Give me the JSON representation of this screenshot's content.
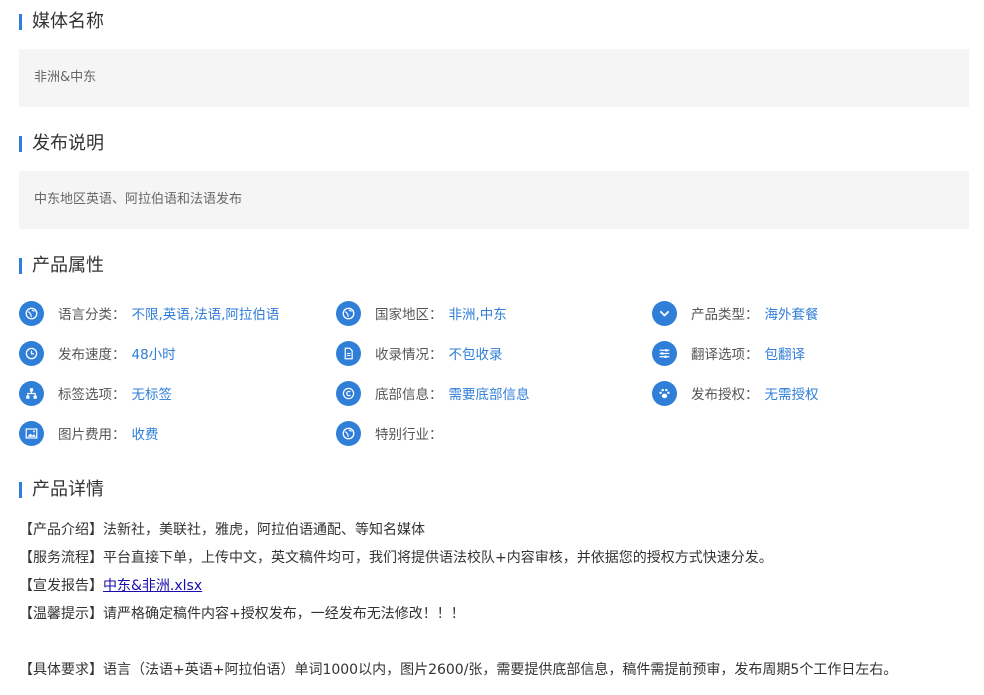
{
  "sections": {
    "media": {
      "title": "媒体名称",
      "value": "非洲&中东"
    },
    "publish": {
      "title": "发布说明",
      "value": "中东地区英语、阿拉伯语和法语发布"
    },
    "attributes": {
      "title": "产品属性"
    },
    "details": {
      "title": "产品详情"
    }
  },
  "attributes": [
    {
      "label": "语言分类：",
      "value": "不限,英语,法语,阿拉伯语",
      "icon": "globe-icon"
    },
    {
      "label": "国家地区：",
      "value": "非洲,中东",
      "icon": "globe-icon"
    },
    {
      "label": "产品类型：",
      "value": "海外套餐",
      "icon": "chevron-down-icon"
    },
    {
      "label": "发布速度：",
      "value": "48小时",
      "icon": "clock-icon"
    },
    {
      "label": "收录情况：",
      "value": "不包收录",
      "icon": "document-icon"
    },
    {
      "label": "翻译选项：",
      "value": "包翻译",
      "icon": "sliders-icon"
    },
    {
      "label": "标签选项：",
      "value": "无标签",
      "icon": "sitemap-icon"
    },
    {
      "label": "底部信息：",
      "value": "需要底部信息",
      "icon": "copyright-icon"
    },
    {
      "label": "发布授权：",
      "value": "无需授权",
      "icon": "paw-icon"
    },
    {
      "label": "图片费用：",
      "value": "收费",
      "icon": "image-icon"
    },
    {
      "label": "特别行业：",
      "value": "",
      "icon": "globe-icon"
    }
  ],
  "details": {
    "intro_label": "【产品介绍】",
    "intro_text": "法新社，美联社，雅虎，阿拉伯语通配、等知名媒体",
    "process_label": "【服务流程】",
    "process_text": "平台直接下单，上传中文，英文稿件均可，我们将提供语法校队+内容审核，并依据您的授权方式快速分发。",
    "report_label": "【宣发报告】",
    "report_link": "中东&非洲.xlsx",
    "tip_label": "【温馨提示】",
    "tip_text": "请严格确定稿件内容+授权发布，一经发布无法修改！！！",
    "require_label": "【具体要求】",
    "require_text": "语言（法语+英语+阿拉伯语）单词1000以内，图片2600/张，需要提供底部信息，稿件需提前预审，发布周期5个工作日左右。"
  },
  "colors": {
    "accent": "#2f7ed8",
    "box_bg": "#f5f5f5"
  }
}
